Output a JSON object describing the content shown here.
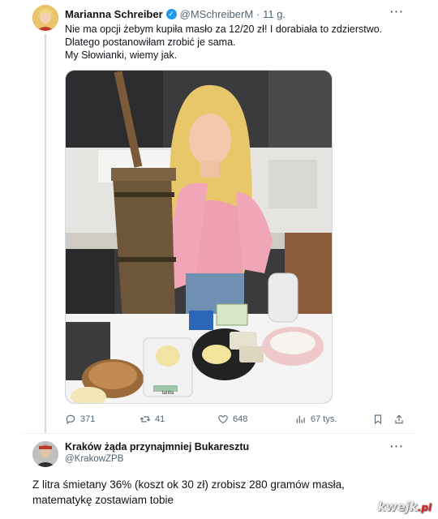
{
  "tweet": {
    "author_name": "Marianna Schreiber",
    "handle": "@MSchreiberM",
    "time": "· 11 g.",
    "more_label": "···",
    "text_lines": [
      "Nie ma opcji żebym kupiła masło za 12/20 zł! I dorabiała to zdzierstwo.",
      "Dlatego postanowiłam zrobić je sama.",
      "My Słowianki, wiemy jak."
    ],
    "scale_brand": "tanita",
    "actions": {
      "replies": "371",
      "reposts": "41",
      "likes": "648",
      "views": "67 tys."
    }
  },
  "reply": {
    "author_name": "Kraków żąda przynajmniej Bukaresztu",
    "handle": "@KrakowZPB",
    "more_label": "···",
    "text": "Z litra śmietany 36% (koszt ok 30 zł) zrobisz 280 gramów masła, matematykę zostawiam tobie"
  },
  "watermark": {
    "main": "kwejk",
    "suffix": ".pl"
  },
  "colors": {
    "verified": "#1d9bf0",
    "muted_text": "#536471",
    "thread_line": "#cfd9de"
  },
  "icons": [
    "verified-badge-icon",
    "more-icon",
    "reply-icon",
    "repost-icon",
    "like-icon",
    "views-icon",
    "bookmark-icon",
    "share-icon"
  ]
}
